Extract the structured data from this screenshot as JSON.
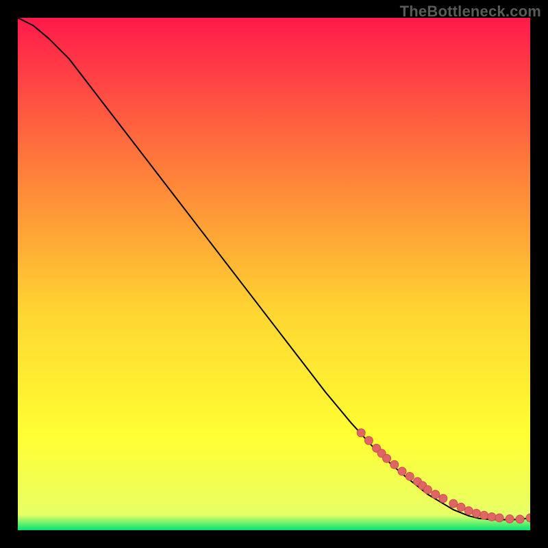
{
  "watermark": "TheBottleneck.com",
  "colors": {
    "bg": "#000000",
    "gradient_top": "#ff1a4b",
    "gradient_mid1": "#ff7f3a",
    "gradient_mid2": "#ffd731",
    "gradient_mid3": "#ffff33",
    "gradient_bottom": "#00e673",
    "line": "#000000",
    "marker_fill": "#e06666",
    "marker_stroke": "#cc4e4e"
  },
  "chart_data": {
    "type": "line",
    "title": "",
    "xlabel": "",
    "ylabel": "",
    "xlim": [
      0,
      100
    ],
    "ylim": [
      0,
      100
    ],
    "series": [
      {
        "name": "curve",
        "x": [
          0,
          3,
          6,
          10,
          15,
          20,
          25,
          30,
          35,
          40,
          45,
          50,
          55,
          60,
          65,
          70,
          75,
          80,
          85,
          88,
          90,
          92,
          94,
          96,
          98,
          100
        ],
        "y": [
          100,
          98.5,
          96,
          92,
          85.5,
          79,
          72.5,
          66,
          59.5,
          53,
          46.5,
          40,
          33.5,
          27,
          21,
          15.5,
          11,
          7,
          4,
          2.8,
          2.3,
          2.1,
          2.05,
          2.05,
          2.1,
          2.4
        ]
      }
    ],
    "markers": {
      "name": "points",
      "x": [
        67,
        68.5,
        70,
        71,
        72,
        73.5,
        75,
        76.5,
        78,
        79,
        80,
        81.5,
        83,
        85,
        86.5,
        88,
        89.5,
        91,
        92.5,
        94,
        96,
        98,
        100
      ],
      "y": [
        19,
        17.5,
        16,
        15,
        14,
        12.8,
        11.5,
        10.5,
        9.5,
        8.7,
        7.9,
        7,
        6.2,
        5.2,
        4.5,
        3.8,
        3.3,
        2.9,
        2.6,
        2.4,
        2.2,
        2.15,
        2.4
      ]
    }
  }
}
